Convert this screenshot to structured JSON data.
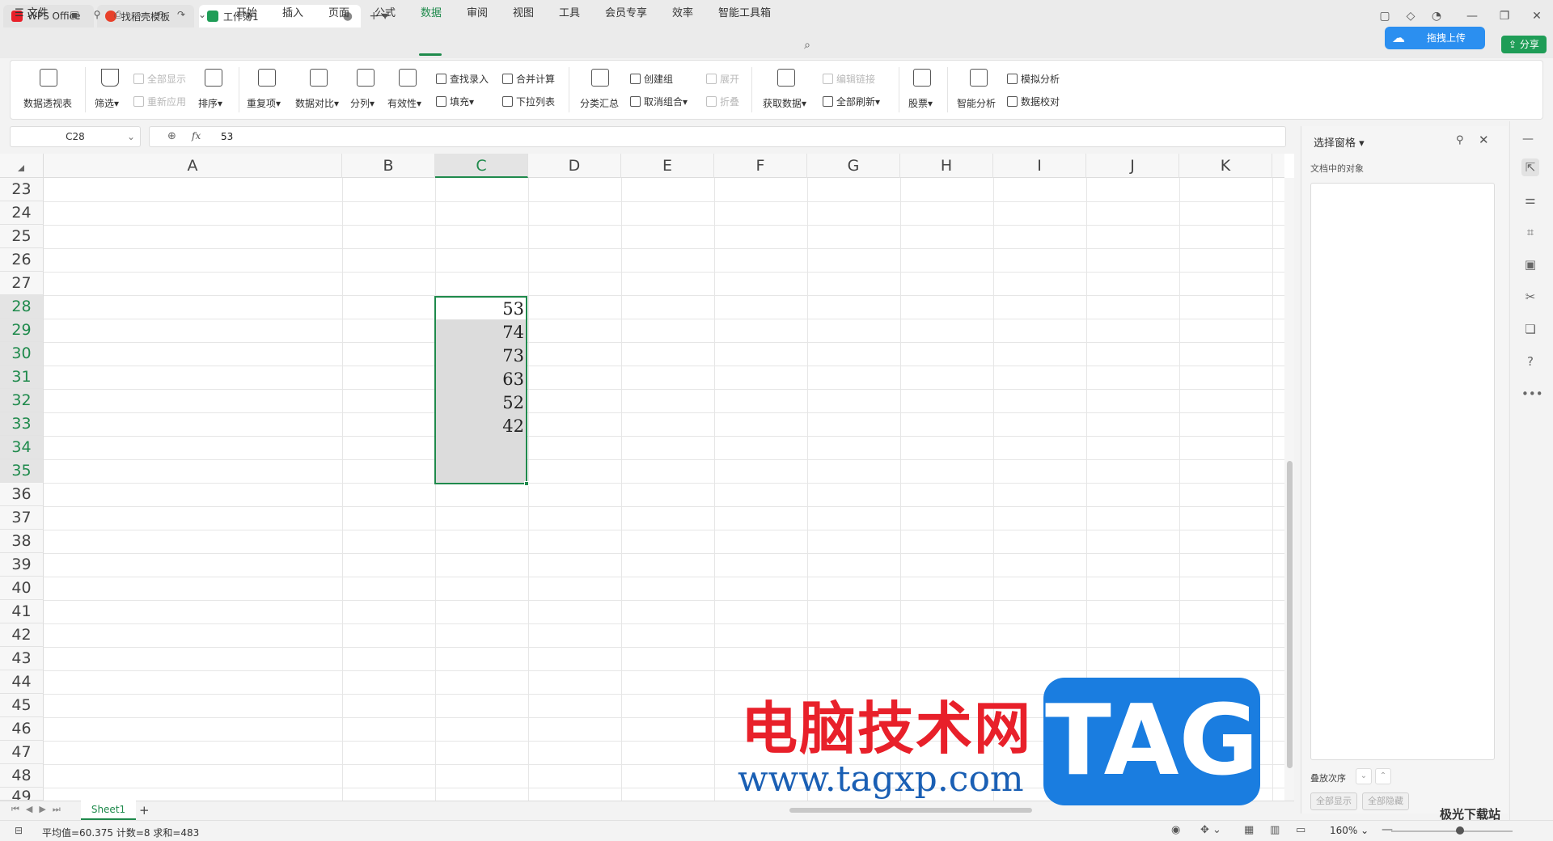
{
  "tabs": [
    {
      "label": "WPS Office"
    },
    {
      "label": "找稻壳模板"
    },
    {
      "label": "工作簿1"
    }
  ],
  "menu": {
    "file": "文件",
    "items": [
      "开始",
      "插入",
      "页面",
      "公式",
      "数据",
      "审阅",
      "视图",
      "工具",
      "会员专享",
      "效率",
      "智能工具箱"
    ],
    "active": "数据"
  },
  "toolbar": {
    "upload": "拖拽上传",
    "share": "分享"
  },
  "ribbon": {
    "pivot": "数据透视表",
    "filter": "筛选",
    "show_all": "全部显示",
    "reapply": "重新应用",
    "sort": "排序",
    "duplicates": "重复项",
    "compare": "数据对比",
    "split": "分列",
    "validity": "有效性",
    "lookup_entry": "查找录入",
    "fill": "填充",
    "consolidate": "合并计算",
    "dropdown": "下拉列表",
    "subtotal": "分类汇总",
    "group": "创建组",
    "ungroup": "取消组合",
    "expand": "展开",
    "collapse": "折叠",
    "get_data": "获取数据",
    "edit_links": "编辑链接",
    "refresh_all": "全部刷新",
    "stocks": "股票",
    "smart_analysis": "智能分析",
    "what_if": "模拟分析",
    "data_check": "数据校对"
  },
  "formula": {
    "cell_ref": "C28",
    "fx": "fx",
    "value": "53"
  },
  "grid": {
    "columns": [
      "A",
      "B",
      "C",
      "D",
      "E",
      "F",
      "G",
      "H",
      "I",
      "J",
      "K"
    ],
    "rows": [
      "23",
      "24",
      "25",
      "26",
      "27",
      "28",
      "29",
      "30",
      "31",
      "32",
      "33",
      "34",
      "35",
      "36",
      "37",
      "38",
      "39",
      "40",
      "41",
      "42",
      "43",
      "44",
      "45",
      "46",
      "47",
      "48",
      "49"
    ],
    "selected_column": "C",
    "c_values": [
      "53",
      "74",
      "73",
      "63",
      "52",
      "42"
    ]
  },
  "sheet_tab": {
    "name": "Sheet1",
    "add": "+"
  },
  "status": {
    "text": "平均值=60.375  计数=8  求和=483",
    "zoom": "160%"
  },
  "pane": {
    "title": "选择窗格",
    "subtitle": "文档中的对象",
    "order": "叠放次序",
    "show_all": "全部显示",
    "hide_all": "全部隐藏"
  },
  "watermark": {
    "cn": "电脑技术网",
    "url": "www.tagxp.com",
    "tag": "TAG",
    "site": "极光下载站"
  }
}
